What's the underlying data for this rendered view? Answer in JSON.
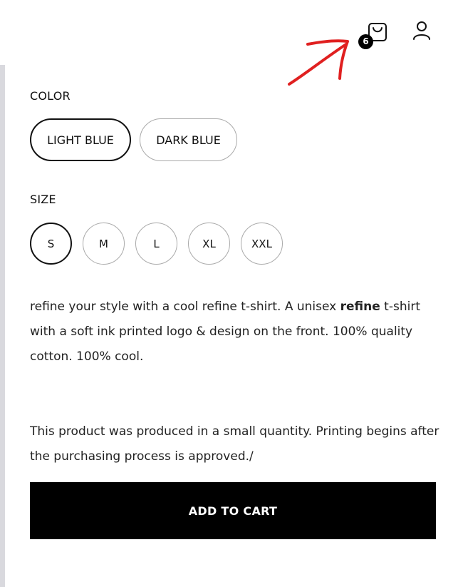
{
  "header": {
    "cart_icon": "shopping-bag-icon",
    "cart_count": "6",
    "user_icon": "user-icon",
    "annotation": "red-arrow-icon",
    "annotation_color": "#e02020"
  },
  "options": {
    "color_label": "COLOR",
    "colors": [
      {
        "label": "LIGHT BLUE",
        "selected": true
      },
      {
        "label": "DARK BLUE",
        "selected": false
      }
    ],
    "size_label": "SIZE",
    "sizes": [
      {
        "label": "S",
        "selected": true
      },
      {
        "label": "M",
        "selected": false
      },
      {
        "label": "L",
        "selected": false
      },
      {
        "label": "XL",
        "selected": false
      },
      {
        "label": "XXL",
        "selected": false
      }
    ]
  },
  "description": {
    "part1": "refine your style with a cool refine t-shirt. A unisex ",
    "bold": "refine",
    "part2": " t-shirt with a soft ink printed logo & design on the front. 100% quality cotton. 100% cool."
  },
  "note": "This product was produced in a small quantity. Printing begins after the purchasing process is approved./",
  "add_to_cart_label": "ADD TO CART"
}
